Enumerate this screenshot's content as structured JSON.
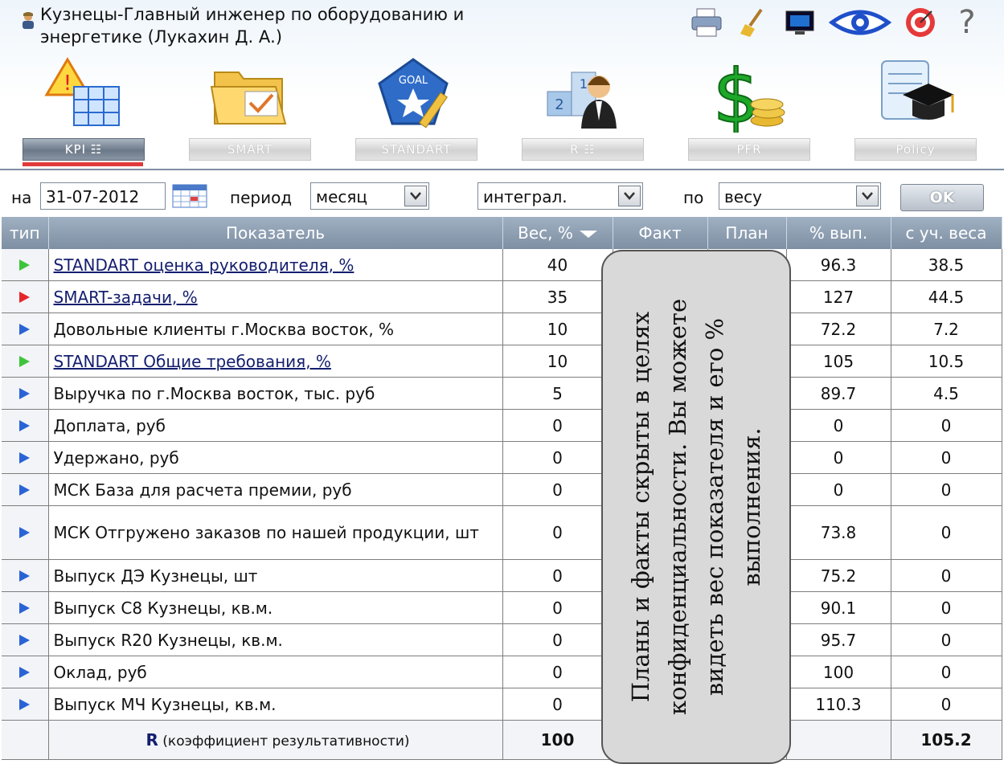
{
  "header": {
    "title_line1": "Кузнецы-Главный инженер по оборудованию и",
    "title_line2": "энергетике  (Лукахин Д. А.)"
  },
  "toolbar": {
    "icons": [
      "printer-icon",
      "broom-icon",
      "monitor-icon",
      "eye-icon",
      "target-icon",
      "help-icon"
    ],
    "help_glyph": "?"
  },
  "modules": [
    {
      "label": "KPI ☷",
      "icon": "kpi-warning-table-icon",
      "active": true
    },
    {
      "label": "SMART",
      "icon": "folder-check-icon",
      "active": false
    },
    {
      "label": "STANDART",
      "icon": "goal-badge-icon",
      "active": false
    },
    {
      "label": "R ☷",
      "icon": "podium-person-icon",
      "active": false
    },
    {
      "label": "PFR",
      "icon": "dollar-coins-icon",
      "active": false
    },
    {
      "label": "Policy",
      "icon": "scroll-graduation-cap-icon",
      "active": false
    }
  ],
  "filters": {
    "date_label": "на",
    "date_value": "31-07-2012",
    "period_label": "период",
    "period_value": "месяц",
    "mode_value": "интеграл.",
    "sort_label": "по",
    "sort_value": "весу",
    "ok_label": "OK"
  },
  "table": {
    "columns": [
      "тип",
      "Показатель",
      "Вес, %",
      "Факт",
      "План",
      "% вып.",
      "с уч. веса"
    ],
    "rows": [
      {
        "marker": "green",
        "name": "STANDART оценка руководителя, %",
        "link": true,
        "weight": "40",
        "pct": "96.3",
        "weighted": "38.5"
      },
      {
        "marker": "red",
        "name": "SMART-задачи, %",
        "link": true,
        "weight": "35",
        "pct": "127",
        "weighted": "44.5"
      },
      {
        "marker": "blue",
        "name": "Довольные клиенты г.Москва восток, %",
        "link": false,
        "weight": "10",
        "pct": "72.2",
        "weighted": "7.2"
      },
      {
        "marker": "green",
        "name": "STANDART Общие требования, %",
        "link": true,
        "weight": "10",
        "pct": "105",
        "weighted": "10.5"
      },
      {
        "marker": "blue",
        "name": "Выручка по г.Москва восток, тыс. руб",
        "link": false,
        "weight": "5",
        "pct": "89.7",
        "weighted": "4.5"
      },
      {
        "marker": "blue",
        "name": "Доплата, руб",
        "link": false,
        "weight": "0",
        "pct": "0",
        "weighted": "0"
      },
      {
        "marker": "blue",
        "name": "Удержано, руб",
        "link": false,
        "weight": "0",
        "pct": "0",
        "weighted": "0"
      },
      {
        "marker": "blue",
        "name": "МСК База для расчета премии, руб",
        "link": false,
        "weight": "0",
        "pct": "0",
        "weighted": "0"
      },
      {
        "marker": "blue",
        "name": "МСК Отгружено заказов по нашей продукции, шт",
        "link": false,
        "weight": "0",
        "pct": "73.8",
        "weighted": "0",
        "tall": true
      },
      {
        "marker": "blue",
        "name": "Выпуск ДЭ Кузнецы, шт",
        "link": false,
        "weight": "0",
        "pct": "75.2",
        "weighted": "0"
      },
      {
        "marker": "blue",
        "name": "Выпуск С8 Кузнецы, кв.м.",
        "link": false,
        "weight": "0",
        "pct": "90.1",
        "weighted": "0"
      },
      {
        "marker": "blue",
        "name": "Выпуск R20 Кузнецы, кв.м.",
        "link": false,
        "weight": "0",
        "pct": "95.7",
        "weighted": "0"
      },
      {
        "marker": "blue",
        "name": "Оклад, руб",
        "link": false,
        "weight": "0",
        "pct": "100",
        "weighted": "0"
      },
      {
        "marker": "blue",
        "name": "Выпуск МЧ Кузнецы, кв.м.",
        "link": false,
        "weight": "0",
        "pct": "110.3",
        "weighted": "0"
      }
    ],
    "total": {
      "label_bold": "R",
      "label_rest": " (коэффициент результативности)",
      "weight": "100",
      "weighted": "105.2"
    }
  },
  "note": {
    "text": "Планы и факты скрыты в целях конфиденциальности. Вы можете видеть вес показателя и его % выполнения."
  },
  "colors": {
    "header_bg": "#9fb0c2",
    "active_tab_underline": "#e03a3a",
    "marker_green": "#3ec43a",
    "marker_red": "#e5262a",
    "marker_blue": "#2a63d6",
    "link": "#141e6e"
  }
}
